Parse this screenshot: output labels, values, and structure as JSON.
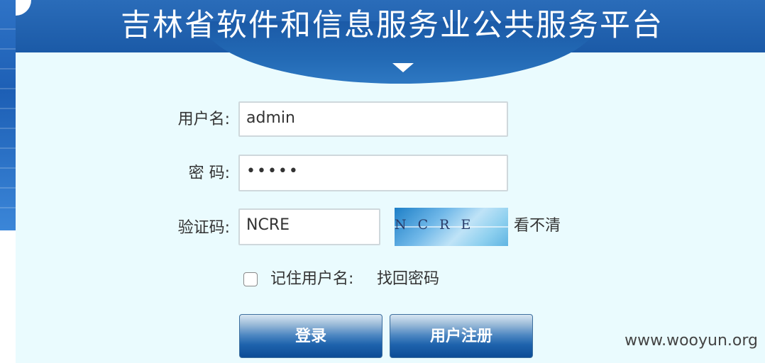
{
  "header": {
    "title": "吉林省软件和信息服务业公共服务平台"
  },
  "login_form": {
    "username_label": "用户名:",
    "username_value": "admin",
    "password_label": "密 码:",
    "password_value": "•••••",
    "captcha_label": "验证码:",
    "captcha_value": "NCRE",
    "captcha_image_text": "NCRE",
    "captcha_refresh": "看不清",
    "remember_label": "记住用户名:",
    "forgot_password": "找回密码",
    "login_button": "登录",
    "register_button": "用户注册"
  },
  "watermark": "www.wooyun.org"
}
